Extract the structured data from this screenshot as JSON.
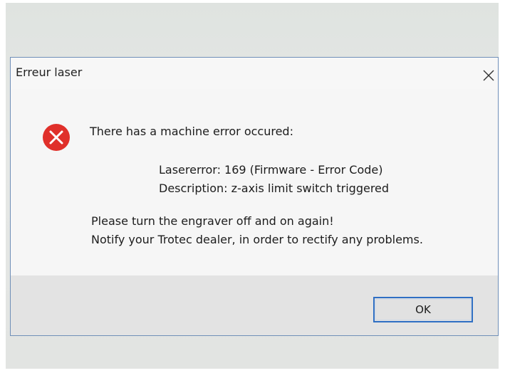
{
  "dialog": {
    "title": "Erreur laser",
    "close_icon": "close-icon",
    "icon": "error-icon",
    "icon_color": "#e0302a",
    "accent": "#2f6fc4",
    "message": {
      "heading": "There has a machine error occured:",
      "error_line": "Lasererror: 169 (Firmware - Error Code)",
      "description_line": "Description: z-axis limit switch triggered",
      "instruction_1": "Please turn the engraver off and on again!",
      "instruction_2": "Notify your Trotec dealer, in order to rectify any problems."
    },
    "ok_label": "OK"
  }
}
